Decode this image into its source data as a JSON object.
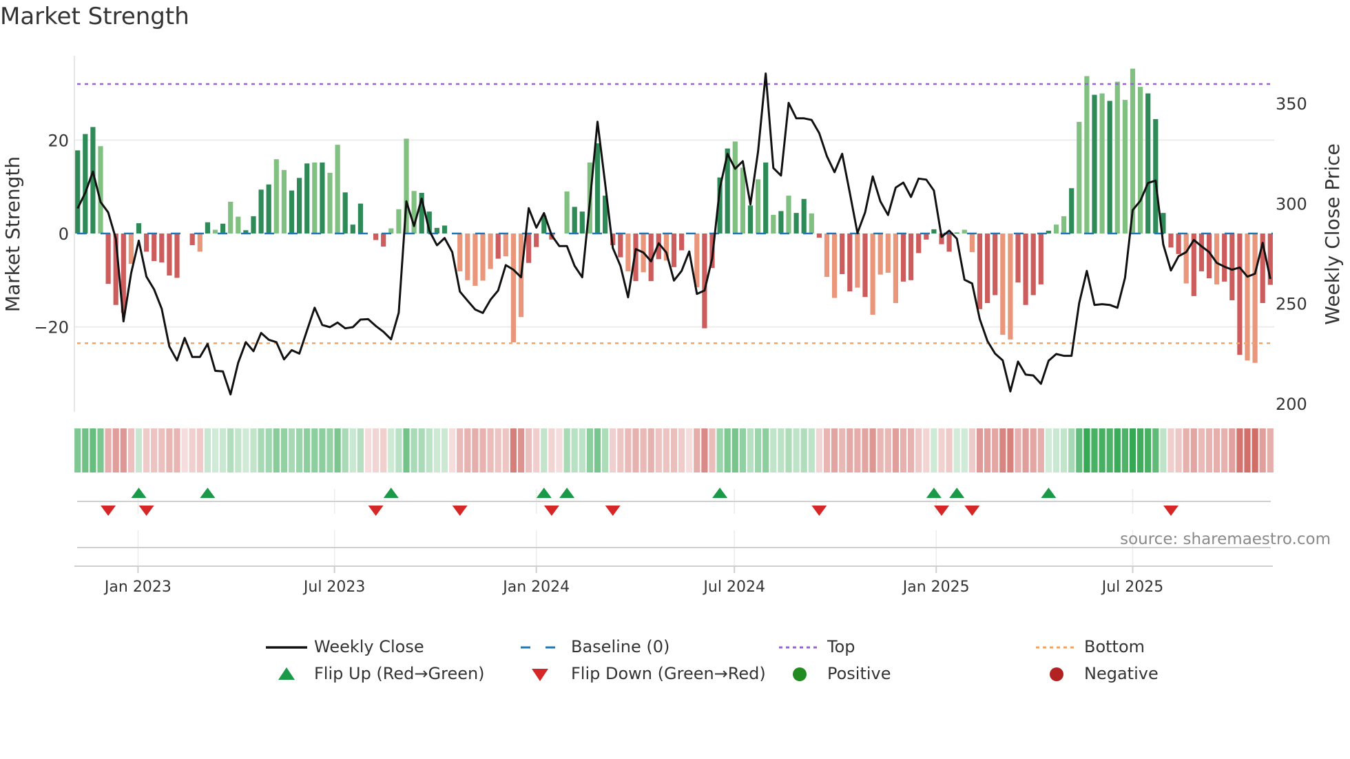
{
  "title": "Market Strength",
  "source": "source: sharemaestro.com",
  "chart_data": {
    "type": "bar",
    "title": "Market Strength",
    "ylabel": "Market Strength",
    "y2label": "Weekly Close Price",
    "ylim": [
      -39,
      39
    ],
    "y2lim": [
      200,
      370
    ],
    "y_ticks": [
      {
        "value": 20,
        "label": "20"
      },
      {
        "value": 0,
        "label": "0"
      },
      {
        "value": -20,
        "label": "−20"
      }
    ],
    "y2_ticks": [
      {
        "value": 350,
        "label": "350"
      },
      {
        "value": 300,
        "label": "300"
      },
      {
        "value": 250,
        "label": "250"
      },
      {
        "value": 200,
        "label": "200"
      }
    ],
    "x_ticks": [
      {
        "week": 8.9,
        "label": "Jan 2023"
      },
      {
        "week": 34.6,
        "label": "Jul 2023"
      },
      {
        "week": 61.0,
        "label": "Jan 2024"
      },
      {
        "week": 86.9,
        "label": "Jul 2024"
      },
      {
        "week": 113.3,
        "label": "Jan 2025"
      },
      {
        "week": 139.0,
        "label": "Jul 2025"
      }
    ],
    "top_level": 32,
    "bottom_level": -23.5,
    "baseline": 0,
    "colors": {
      "strong_positive": "#2e8b57",
      "weak_positive": "#80c080",
      "strong_negative": "#cd5c5c",
      "weak_negative": "#e9967a",
      "close": "#111111",
      "baseline": "#1f77b4",
      "top": "#9b5fe0",
      "bottom": "#f4a460",
      "flip_up": "#1a9a48",
      "flip_down": "#d62728",
      "positive": "#228b22",
      "negative": "#b22222"
    },
    "strength": [
      17.8,
      21.3,
      22.8,
      18.7,
      -10.8,
      -15.3,
      -17,
      -6.5,
      2.2,
      -3.9,
      -5.9,
      -6.2,
      -9.0,
      -9.5,
      0,
      -2.5,
      -3.9,
      2.4,
      0.8,
      2.1,
      6.8,
      3.6,
      0.7,
      3.7,
      9.4,
      10.5,
      15.9,
      13.6,
      9.2,
      11.9,
      15.0,
      15.2,
      15.2,
      13.0,
      19.0,
      8.8,
      1.9,
      6.4,
      0,
      -1.4,
      -2.8,
      1.1,
      5.2,
      20.3,
      9.1,
      8.7,
      4.7,
      1.2,
      1.7,
      0,
      -8.1,
      -10.0,
      -11.2,
      -10.1,
      -7.6,
      -5.4,
      -4.9,
      -23.3,
      -17.9,
      -6.3,
      -2.9,
      3.8,
      -1.3,
      0,
      9.0,
      5.7,
      4.7,
      15.2,
      19.3,
      8.1,
      -2.5,
      -5.1,
      -8.1,
      -10.2,
      -8.3,
      -10.2,
      -5.5,
      -5.8,
      -7.2,
      -3.6,
      0,
      -11.5,
      -20.3,
      -7.4,
      12.0,
      18.2,
      19.7,
      14.1,
      6.0,
      11.6,
      15.2,
      4.0,
      4.8,
      8.1,
      4.4,
      7.4,
      4.3,
      -0.9,
      -9.3,
      -13.8,
      -8.7,
      -12.4,
      -11.6,
      -13.6,
      -17.4,
      -8.8,
      -8.4,
      -14.9,
      -10.3,
      -10.0,
      -4.2,
      -1.3,
      0.9,
      -2.3,
      -3.9,
      0.2,
      0.8,
      -4.0,
      -16.2,
      -14.9,
      -13.2,
      -21.7,
      -22.7,
      -10.5,
      -15.3,
      -13.2,
      -10.9,
      0.6,
      1.9,
      3.7,
      9.7,
      23.9,
      33.7,
      29.7,
      30.0,
      28.4,
      32.5,
      28.6,
      35.3,
      31.4,
      30.0,
      24.5,
      4.4,
      -3.0,
      -4.4,
      -10.7,
      -13.4,
      -8.1,
      -9.6,
      -10.9,
      -10.3,
      -14.3,
      -26.0,
      -27.2,
      -27.7,
      -14.9,
      -11.0
    ],
    "strength_shade": "dddldddlddddd-ddldldllddddlldddldlld-ddddlllld-dddllllldlll-d-dllddlddddldlddl-ddlddddlldldldlddldllddldllllddddddddlldddlldddddlldlldldlllldddddldddldddll",
    "weekly_close": [
      297.5,
      305.3,
      315.9,
      300.7,
      295.5,
      282.4,
      241.1,
      265.2,
      281.4,
      263.4,
      257.1,
      247.4,
      228.5,
      221.6,
      232.8,
      223.3,
      223.3,
      229.8,
      216.4,
      216.1,
      204.6,
      220.4,
      230.7,
      226.2,
      235.3,
      231.9,
      230.7,
      222.1,
      226.7,
      225.0,
      236.5,
      247.9,
      239.3,
      238.2,
      240.5,
      237.6,
      238.2,
      242.0,
      242.2,
      238.8,
      235.9,
      232.1,
      245.4,
      301.0,
      288.7,
      302.4,
      286.4,
      279.1,
      282.7,
      275.7,
      256.0,
      251.4,
      247.0,
      245.3,
      251.9,
      256.5,
      269.2,
      266.9,
      263.1,
      297.6,
      287.9,
      295.2,
      284.1,
      278.7,
      278.7,
      268.8,
      263.1,
      300.7,
      340.8,
      309.9,
      277.8,
      268.8,
      253.1,
      277.2,
      275.5,
      271.1,
      280.1,
      275.5,
      261.5,
      266.3,
      276.0,
      254.8,
      256.5,
      272.6,
      307.6,
      324.8,
      317.3,
      321.1,
      299.5,
      325.9,
      364.9,
      317.7,
      313.9,
      350.2,
      342.5,
      342.5,
      341.7,
      335.1,
      323.6,
      315.6,
      324.8,
      305.3,
      285.2,
      295.5,
      313.5,
      301.0,
      294.2,
      307.9,
      310.4,
      303.2,
      312.4,
      311.9,
      306.4,
      283.3,
      286.4,
      282.4,
      261.9,
      260.0,
      242.2,
      231.3,
      225.0,
      221.6,
      206.1,
      221.0,
      214.5,
      214.1,
      209.9,
      221.4,
      224.8,
      223.9,
      223.9,
      250.2,
      266.3,
      249.3,
      249.7,
      249.3,
      247.9,
      262.9,
      296.7,
      301.3,
      310.2,
      311.4,
      279.5,
      266.5,
      273.6,
      275.7,
      281.8,
      278.6,
      275.7,
      270.3,
      268.4,
      266.9,
      268.0,
      263.4,
      264.9,
      280.3,
      262.3
    ],
    "flip_up_weeks": [
      9,
      18,
      42,
      62,
      65,
      85,
      113,
      116,
      128
    ],
    "flip_down_weeks": [
      5,
      10,
      40,
      51,
      63,
      71,
      98,
      114,
      118,
      144
    ],
    "legend": {
      "position": "bottom",
      "items": [
        {
          "label": "Weekly Close",
          "symbol": "line"
        },
        {
          "label": "Baseline (0)",
          "symbol": "dash"
        },
        {
          "label": "Top",
          "symbol": "dot-purple"
        },
        {
          "label": "Bottom",
          "symbol": "dot-orange"
        },
        {
          "label": "Flip Up (Red→Green)",
          "symbol": "triangle-up"
        },
        {
          "label": "Flip Down (Green→Red)",
          "symbol": "triangle-down"
        },
        {
          "label": "Positive",
          "symbol": "circle-green"
        },
        {
          "label": "Negative",
          "symbol": "circle-red"
        }
      ]
    }
  }
}
